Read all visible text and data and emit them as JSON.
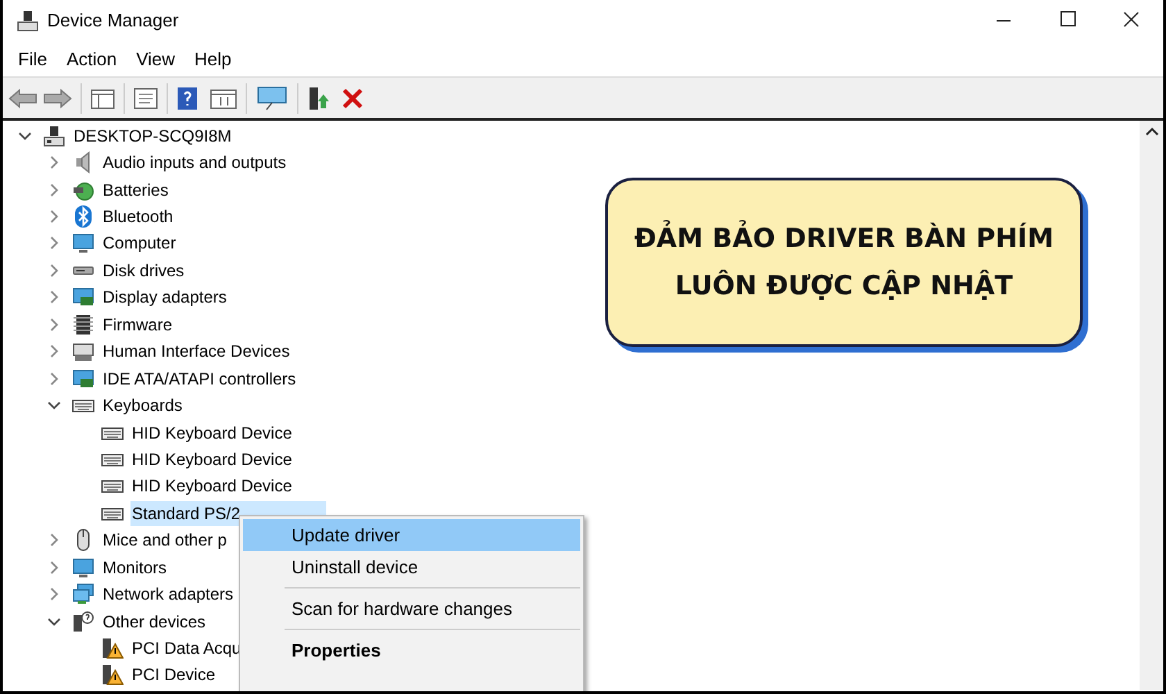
{
  "window": {
    "title": "Device Manager"
  },
  "menu_bar": [
    "File",
    "Action",
    "View",
    "Help"
  ],
  "tree": [
    {
      "label": "DESKTOP-SCQ9I8M",
      "kind": "computer",
      "expanded": true,
      "selected": false,
      "children": [
        {
          "label": "Audio inputs and outputs",
          "kind": "audio",
          "expanded": false,
          "selected": false
        },
        {
          "label": "Batteries",
          "kind": "battery",
          "expanded": false,
          "selected": false
        },
        {
          "label": "Bluetooth",
          "kind": "bluetooth",
          "expanded": false,
          "selected": false
        },
        {
          "label": "Computer",
          "kind": "monitor",
          "expanded": false,
          "selected": false
        },
        {
          "label": "Disk drives",
          "kind": "disk",
          "expanded": false,
          "selected": false
        },
        {
          "label": "Display adapters",
          "kind": "display",
          "expanded": false,
          "selected": false
        },
        {
          "label": "Firmware",
          "kind": "chip",
          "expanded": false,
          "selected": false
        },
        {
          "label": "Human Interface Devices",
          "kind": "hid",
          "expanded": false,
          "selected": false
        },
        {
          "label": "IDE ATA/ATAPI controllers",
          "kind": "display",
          "expanded": false,
          "selected": false
        },
        {
          "label": "Keyboards",
          "kind": "keyboard",
          "expanded": true,
          "selected": false,
          "children": [
            {
              "label": "HID Keyboard Device",
              "kind": "keyboard",
              "selected": false
            },
            {
              "label": "HID Keyboard Device",
              "kind": "keyboard",
              "selected": false
            },
            {
              "label": "HID Keyboard Device",
              "kind": "keyboard",
              "selected": false
            },
            {
              "label": "Standard PS/2",
              "kind": "keyboard",
              "selected": true
            }
          ]
        },
        {
          "label": "Mice and other p",
          "kind": "mouse",
          "expanded": false,
          "selected": false
        },
        {
          "label": "Monitors",
          "kind": "monitor",
          "expanded": false,
          "selected": false
        },
        {
          "label": "Network adapters",
          "kind": "network",
          "expanded": false,
          "selected": false
        },
        {
          "label": "Other devices",
          "kind": "unknown",
          "expanded": true,
          "selected": false,
          "children": [
            {
              "label": "PCI Data Acqu",
              "kind": "warning",
              "selected": false
            },
            {
              "label": "PCI Device",
              "kind": "warning",
              "selected": false
            }
          ]
        }
      ]
    }
  ],
  "context_menu": [
    {
      "label": "Update driver",
      "selected": true,
      "bold": false,
      "separator_before": false
    },
    {
      "label": "Uninstall device",
      "selected": false,
      "bold": false,
      "separator_before": false
    },
    {
      "label": "Scan for hardware changes",
      "selected": false,
      "bold": false,
      "separator_before": true
    },
    {
      "label": "Properties",
      "selected": false,
      "bold": true,
      "separator_before": true
    }
  ],
  "banner": {
    "lines": [
      "ĐẢM BẢO DRIVER BÀN PHÍM",
      "LUÔN ĐƯỢC CẬP NHẬT"
    ]
  }
}
